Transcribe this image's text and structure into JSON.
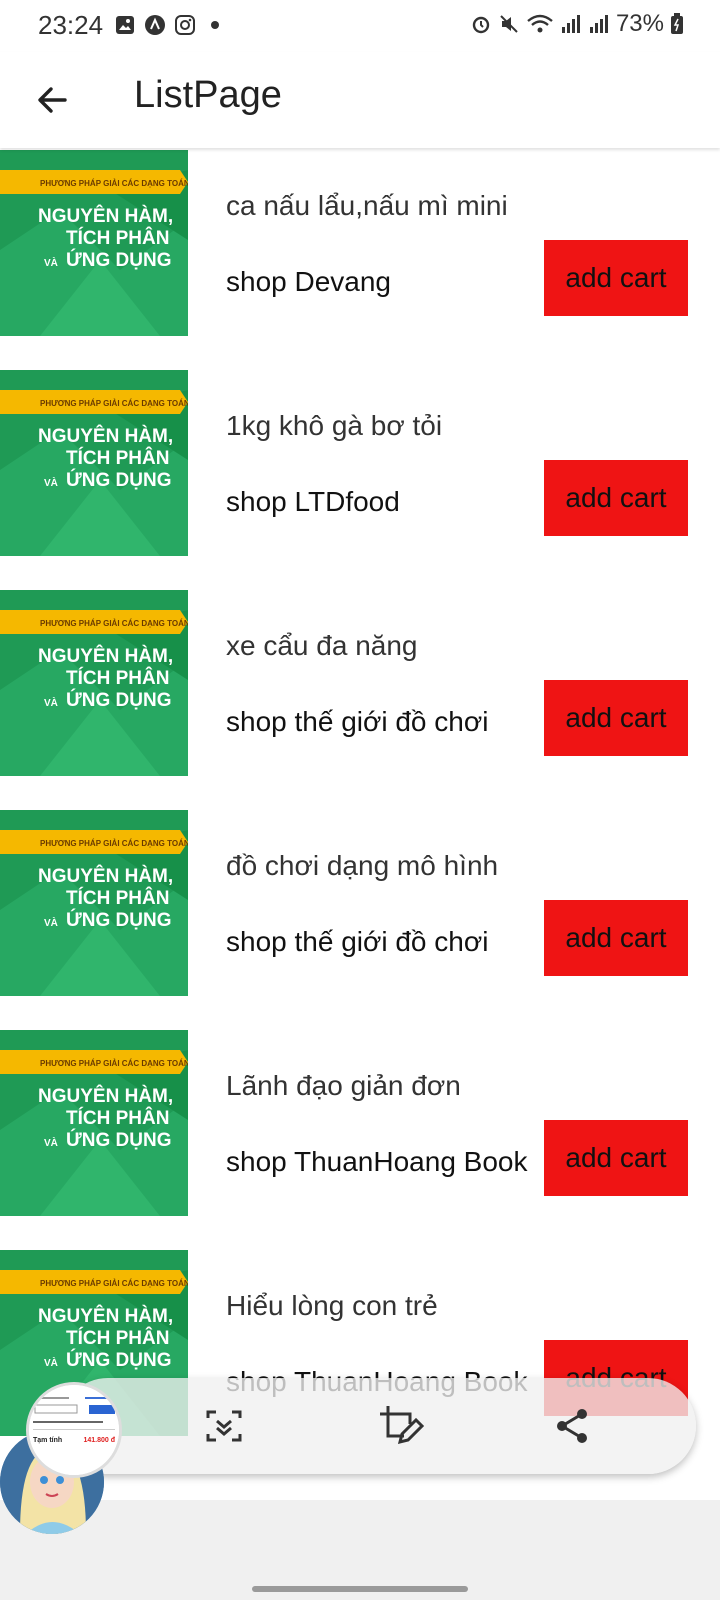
{
  "status": {
    "time": "23:24",
    "battery": "73%"
  },
  "appbar": {
    "title": "ListPage"
  },
  "book_cover": {
    "banner": "PHƯƠNG PHÁP GIẢI CÁC DẠNG TOÁN THPT",
    "line1": "NGUYÊN HÀM,",
    "line2": "TÍCH PHÂN",
    "line3_small": "VÀ",
    "line3": "ỨNG DỤNG"
  },
  "items": [
    {
      "name": "ca nấu lẩu,nấu mì mini",
      "shop": "shop Devang",
      "button": "add cart"
    },
    {
      "name": "1kg khô gà bơ tỏi",
      "shop": "shop LTDfood",
      "button": "add cart"
    },
    {
      "name": "xe cẩu đa năng",
      "shop": "shop thế giới đồ chơi",
      "button": "add cart"
    },
    {
      "name": "đồ chơi dạng mô hình",
      "shop": "shop thế giới đồ chơi",
      "button": "add cart"
    },
    {
      "name": "Lãnh đạo giản đơn",
      "shop": "shop ThuanHoang Book",
      "button": "add cart"
    },
    {
      "name": "Hiểu lòng con trẻ",
      "shop": "shop ThuanHoang Book",
      "button": "add cart"
    }
  ],
  "preview": {
    "total_label": "Tạm tính",
    "total_value": "141.800 đ"
  },
  "colors": {
    "accent": "#ef1414",
    "cover_green": "#1f9a55",
    "banner_yellow": "#f5b800"
  }
}
